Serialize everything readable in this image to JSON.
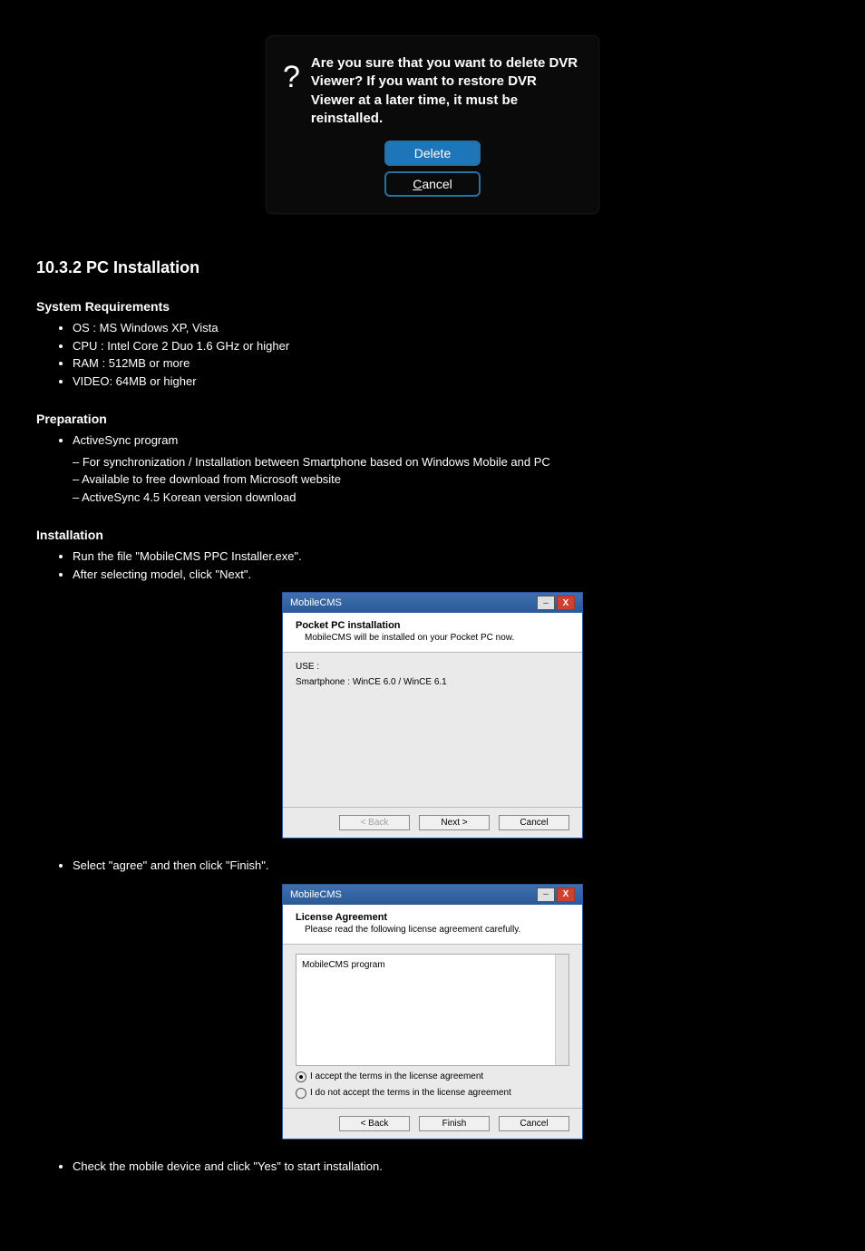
{
  "mobile_dialog": {
    "icon": "?",
    "message": "Are you sure that you want to delete DVR Viewer? If you want to restore DVR Viewer at a later time, it must be reinstalled.",
    "delete_btn": "Delete",
    "cancel_btn_prefix": "C",
    "cancel_btn_rest": "ancel"
  },
  "section_title": "10.3.2 PC Installation",
  "req_h": "System Requirements",
  "req_items": [
    "OS : MS Windows XP, Vista",
    "CPU : Intel Core 2 Duo 1.6 GHz or higher",
    "RAM : 512MB or more",
    "VIDEO: 64MB or higher"
  ],
  "prep_h": "Preparation",
  "prep_intro": "ActiveSync program",
  "prep_items": [
    "For synchronization / Installation between Smartphone based on Windows Mobile and PC",
    "Available to free download from Microsoft website",
    "ActiveSync 4.5 Korean version download"
  ],
  "inst_h": "Installation",
  "inst_step1": "Run the file \"MobileCMS PPC Installer.exe\".",
  "inst_step2": "After selecting model, click \"Next\".",
  "wiz1": {
    "title": "MobileCMS",
    "head": "Pocket PC installation",
    "sub": "MobileCMS will be installed on your Pocket PC now.",
    "body_l1": "USE :",
    "body_l2": "Smartphone : WinCE 6.0 / WinCE 6.1",
    "back": "< Back",
    "next": "Next >",
    "cancel": "Cancel"
  },
  "inst_step3": "Select \"agree\" and then click \"Finish\".",
  "wiz2": {
    "title": "MobileCMS",
    "head": "License Agreement",
    "sub": "Please read the following license agreement carefully.",
    "body": "MobileCMS program",
    "r1": "I accept the terms in the license agreement",
    "r2": "I do not accept the terms in the license agreement",
    "back": "< Back",
    "finish": "Finish",
    "cancel": "Cancel"
  },
  "inst_step4": "Check the mobile device and click \"Yes\" to start installation."
}
